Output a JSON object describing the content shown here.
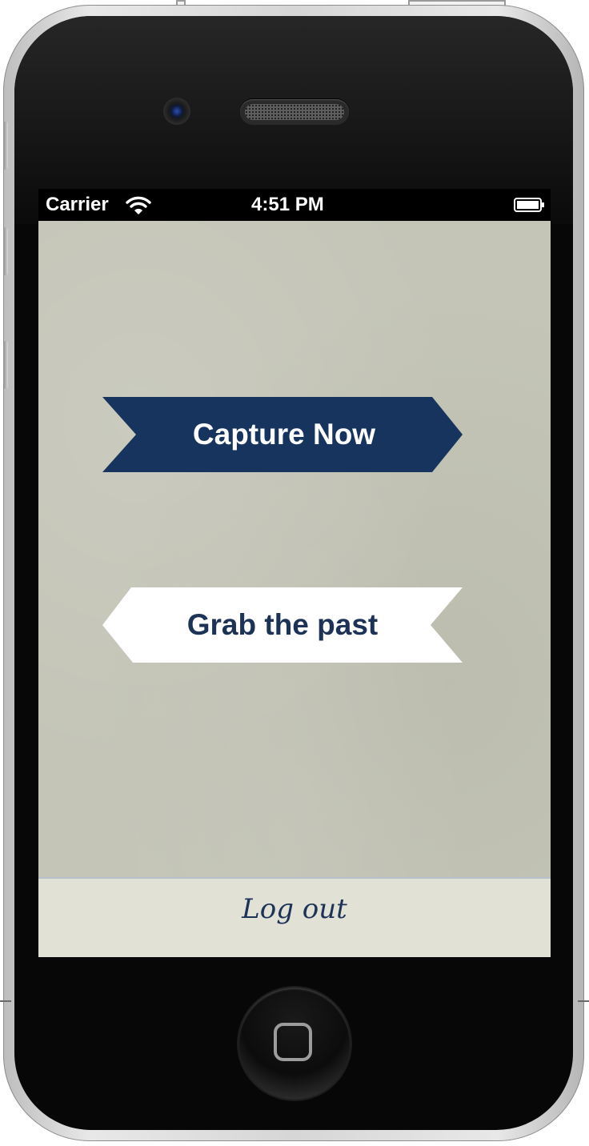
{
  "status_bar": {
    "carrier": "Carrier",
    "time": "4:51 PM"
  },
  "main": {
    "capture_label": "Capture Now",
    "grab_label": "Grab the past"
  },
  "bottom_bar": {
    "logout_label": "Log out"
  },
  "colors": {
    "navy": "#1c3357",
    "paper": "#c4c5b7",
    "bottom_bar": "#e1e1d6",
    "ribbon_white": "#ffffff"
  },
  "icons": {
    "status": [
      "wifi-icon",
      "battery-icon"
    ],
    "device": [
      "camera-lens-icon",
      "speaker-grille-icon",
      "home-button-icon"
    ]
  }
}
